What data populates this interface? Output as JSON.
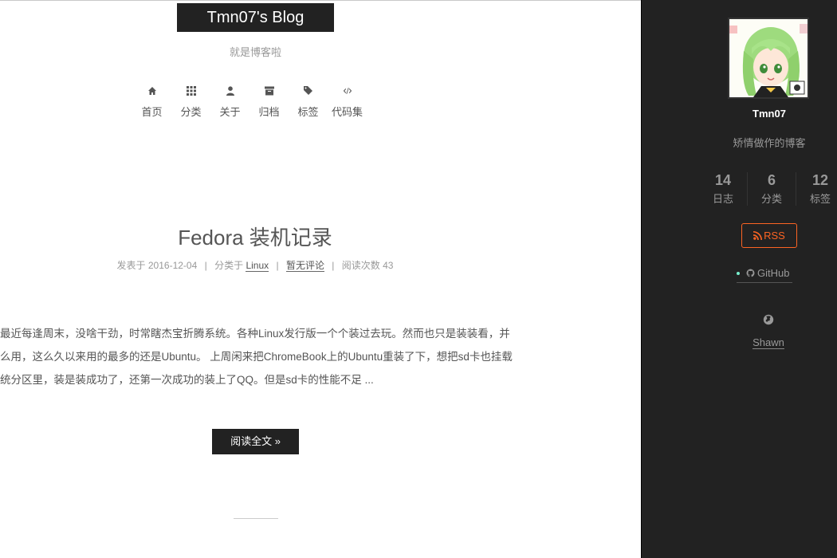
{
  "header": {
    "brand": "Tmn07's Blog",
    "subtitle": "就是博客啦",
    "menu": [
      {
        "label": "首页",
        "icon": "home-icon"
      },
      {
        "label": "分类",
        "icon": "grid-icon"
      },
      {
        "label": "关于",
        "icon": "user-icon"
      },
      {
        "label": "归档",
        "icon": "archive-icon"
      },
      {
        "label": "标签",
        "icon": "tags-icon"
      },
      {
        "label": "代码集",
        "icon": "code-icon"
      }
    ]
  },
  "post": {
    "title": "Fedora 装机记录",
    "meta": {
      "posted_prefix": "发表于 2016-12-04",
      "category_prefix": "分类于",
      "category": "Linux",
      "comments": "暂无评论",
      "views": "阅读次数 43",
      "separator": "|"
    },
    "excerpt_lines": [
      "最近每逢周末，没啥干劲，时常瞎杰宝折腾系统。各种Linux发行版一个个装过去玩。然而也只是装装看，并",
      "么用，这么久以来用的最多的还是Ubuntu。 上周闲来把ChromeBook上的Ubuntu重装了下，想把sd卡也挂载",
      "统分区里，装是装成功了，还第一次成功的装上了QQ。但是sd卡的性能不足 ..."
    ],
    "read_more": "阅读全文 »"
  },
  "sidebar": {
    "author": "Tmn07",
    "description": "矫情做作的博客",
    "stats": [
      {
        "count": "14",
        "label": "日志"
      },
      {
        "count": "6",
        "label": "分类"
      },
      {
        "count": "12",
        "label": "标签"
      }
    ],
    "rss": "RSS",
    "github": "GitHub",
    "link": "Shawn"
  },
  "colors": {
    "sidebar_bg": "#222222",
    "rss_accent": "#fc6423",
    "dark_button": "#222222"
  }
}
